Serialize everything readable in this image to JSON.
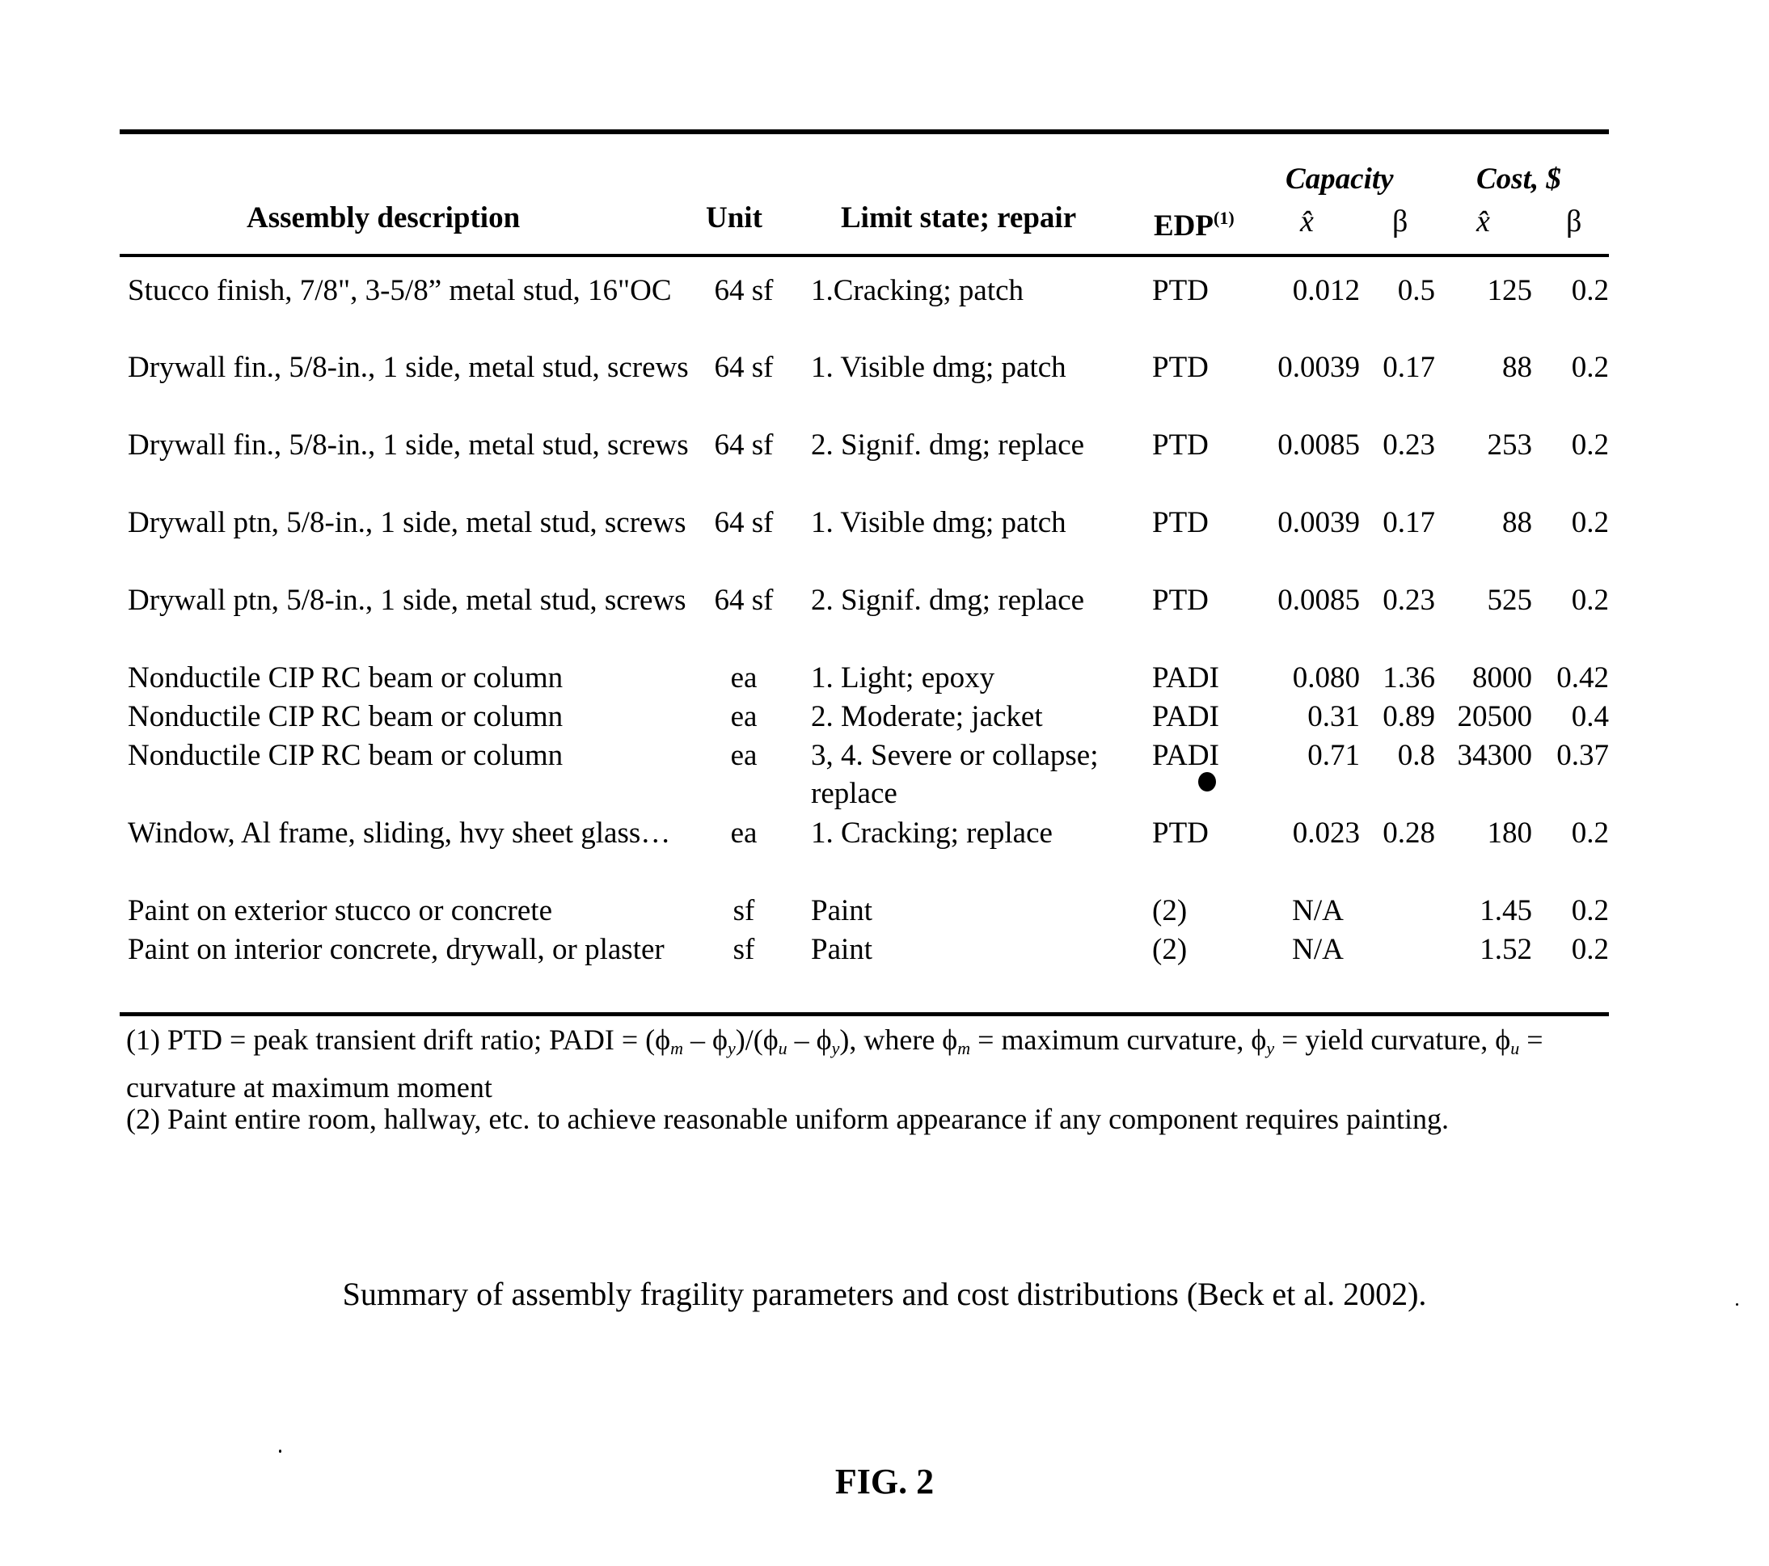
{
  "table": {
    "headers": {
      "assembly": "Assembly description",
      "unit": "Unit",
      "limit_state": "Limit state; repair",
      "edp": "EDP",
      "edp_note": "(1)",
      "capacity_group": "Capacity",
      "cost_group": "Cost, $",
      "median_symbol": "x̂",
      "beta_symbol": "β"
    },
    "rows": [
      {
        "assembly": "Stucco finish, 7/8\", 3-5/8” metal stud, 16\"OC",
        "unit": "64 sf",
        "limit_state": "1.Cracking; patch",
        "edp": "PTD",
        "cap_median": "0.012",
        "cap_beta": "0.5",
        "cost_median": "125",
        "cost_beta": "0.2"
      },
      {
        "assembly": "Drywall fin., 5/8-in., 1 side, metal stud, screws",
        "unit": "64 sf",
        "limit_state": "1. Visible dmg; patch",
        "edp": "PTD",
        "cap_median": "0.0039",
        "cap_beta": "0.17",
        "cost_median": "88",
        "cost_beta": "0.2"
      },
      {
        "assembly": "Drywall fin., 5/8-in., 1 side, metal stud, screws",
        "unit": "64 sf",
        "limit_state": "2. Signif. dmg; replace",
        "edp": "PTD",
        "cap_median": "0.0085",
        "cap_beta": "0.23",
        "cost_median": "253",
        "cost_beta": "0.2"
      },
      {
        "assembly": "Drywall ptn, 5/8-in., 1 side, metal stud, screws",
        "unit": "64 sf",
        "limit_state": "1. Visible dmg; patch",
        "edp": "PTD",
        "cap_median": "0.0039",
        "cap_beta": "0.17",
        "cost_median": "88",
        "cost_beta": "0.2"
      },
      {
        "assembly": "Drywall ptn, 5/8-in., 1 side, metal stud, screws",
        "unit": "64 sf",
        "limit_state": "2. Signif. dmg; replace",
        "edp": "PTD",
        "cap_median": "0.0085",
        "cap_beta": "0.23",
        "cost_median": "525",
        "cost_beta": "0.2"
      },
      {
        "assembly": "Nonductile CIP RC beam or column",
        "unit": "ea",
        "limit_state": "1. Light; epoxy",
        "edp": "PADI",
        "cap_median": "0.080",
        "cap_beta": "1.36",
        "cost_median": "8000",
        "cost_beta": "0.42"
      },
      {
        "assembly": "Nonductile CIP RC beam or column",
        "unit": "ea",
        "limit_state": "2. Moderate; jacket",
        "edp": "PADI",
        "cap_median": "0.31",
        "cap_beta": "0.89",
        "cost_median": "20500",
        "cost_beta": "0.4"
      },
      {
        "assembly": "Nonductile CIP RC beam or column",
        "unit": "ea",
        "limit_state": "3, 4. Severe or collapse; replace",
        "edp": "PADI",
        "cap_median": "0.71",
        "cap_beta": "0.8",
        "cost_median": "34300",
        "cost_beta": "0.37"
      },
      {
        "assembly": "Window, Al frame, sliding, hvy sheet glass…",
        "unit": "ea",
        "limit_state": "1. Cracking; replace",
        "edp": "PTD",
        "cap_median": "0.023",
        "cap_beta": "0.28",
        "cost_median": "180",
        "cost_beta": "0.2"
      },
      {
        "assembly": "Paint on exterior stucco or concrete",
        "unit": "sf",
        "limit_state": "Paint",
        "edp": "(2)",
        "cap_median": "N/A",
        "cap_beta": "",
        "cost_median": "1.45",
        "cost_beta": "0.2"
      },
      {
        "assembly": "Paint on interior concrete, drywall, or plaster",
        "unit": "sf",
        "limit_state": "Paint",
        "edp": "(2)",
        "cap_median": "N/A",
        "cap_beta": "",
        "cost_median": "1.52",
        "cost_beta": "0.2"
      }
    ]
  },
  "footnotes": {
    "note1": {
      "prefix": "(1) PTD = peak transient drift ratio; PADI = (ϕ",
      "sub_m": "m",
      "t1": " – ϕ",
      "sub_y": "y",
      "t2": ")/(ϕ",
      "sub_u": "u",
      "t3": " – ϕ",
      "sub_y2": "y",
      "t4": "), where ϕ",
      "sub_m2": "m",
      "t5": " = maximum curvature, ϕ",
      "sub_y3": "y",
      "t6": " = yield curvature, ϕ",
      "sub_u2": "u",
      "t7": " = curvature at maximum moment"
    },
    "note2": "(2) Paint entire room, hallway, etc. to achieve reasonable uniform appearance if any component requires painting."
  },
  "caption": "Summary of assembly fragility parameters and cost distributions (Beck et al. 2002).",
  "figure_label": "FIG. 2"
}
